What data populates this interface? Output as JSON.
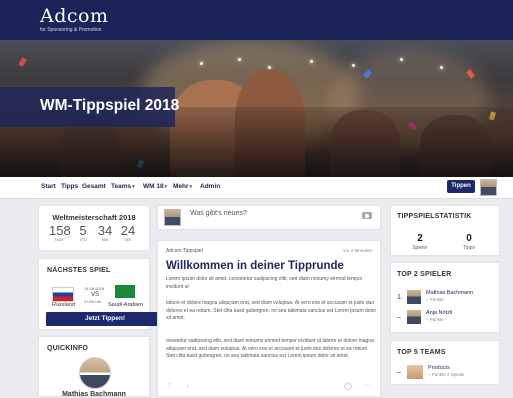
{
  "brand": {
    "name": "Adcom",
    "tagline": "for Sponsoring & Promotion"
  },
  "hero": {
    "title": "WM-Tippspiel 2018"
  },
  "nav": {
    "items": [
      {
        "label": "Start",
        "caret": ""
      },
      {
        "label": "Tipps",
        "caret": ""
      },
      {
        "label": "Gesamt",
        "caret": ""
      },
      {
        "label": "Teams",
        "caret": "▾"
      },
      {
        "label": "WM 18",
        "caret": "▾"
      },
      {
        "label": "Mehr",
        "caret": "▾"
      },
      {
        "label": "Admin",
        "caret": ""
      }
    ],
    "button": "Tippen"
  },
  "countdown": {
    "title": "Weltmeisterschaft 2018",
    "units": [
      {
        "value": "158",
        "label": "TAGE"
      },
      {
        "value": "5",
        "label": "STD"
      },
      {
        "value": "34",
        "label": "MIN"
      },
      {
        "value": "24",
        "label": "SEK"
      }
    ]
  },
  "next_game": {
    "title": "NÄCHSTES SPIEL",
    "date": "14.06.2018",
    "vs": "VS",
    "time": "17:00 Uhr",
    "home": "Russland",
    "away": "Saudi-Arabien",
    "cta": "Jetzt Tippen!"
  },
  "quickinfo": {
    "title": "QUICKINFO",
    "name": "Mathias Bachmann"
  },
  "post_box": {
    "placeholder": "Was gibt's neues?"
  },
  "article": {
    "author": "Adcom Tippspiel",
    "time": "vor 2 Monaten",
    "title": "Willkommen in deiner Tipprunde",
    "paragraphs": [
      "Lorem ipsum dolor sit amet, consetetur sadipscing elitr, sed diam nonumy eirmod tempor invidunt ut",
      "labore et dolore magna aliquyam erat, sed diam voluptua. At vero eos et accusam et justo duo dolores et ea rebum. Stet clita kasd gubergren, no sea takimata sanctus est Lorem ipsum dolor sit amet.",
      "onsetetur sadipscing elitr, sed diam nonumy eirmod tempor invidunt ut labore et dolore magna aliquyam erat, sed diam voluptua. At vero eos et accusam et justo duo dolores et ea rebum. Stet clita kasd gubergren, no sea takimata sanctus est Lorem ipsum dolor sit amet."
    ],
    "actions": {
      "up": "↑",
      "down": "↓",
      "comment": "◯",
      "more": "···"
    }
  },
  "stats": {
    "title": "TIPPSPIELSTATISTIK",
    "items": [
      {
        "value": "2",
        "label": "Spieler"
      },
      {
        "value": "0",
        "label": "Tipps"
      }
    ]
  },
  "top_players": {
    "title": "TOP 2 SPIELER",
    "rows": [
      {
        "rank": "1.",
        "name": "Mathias Bachmann",
        "points": "– Punkte"
      },
      {
        "rank": "–",
        "name": "Anja Nötzli",
        "points": "– Punkte"
      }
    ]
  },
  "top_teams": {
    "title": "TOP 5 TEAMS",
    "rows": [
      {
        "rank": "–",
        "name": "Products",
        "points": "– Punkte 2 Spieler"
      }
    ]
  },
  "colors": {
    "navy": "#1b2358",
    "button": "#1c2a6b",
    "title": "#1f2a60",
    "background": "#e9ebee"
  }
}
